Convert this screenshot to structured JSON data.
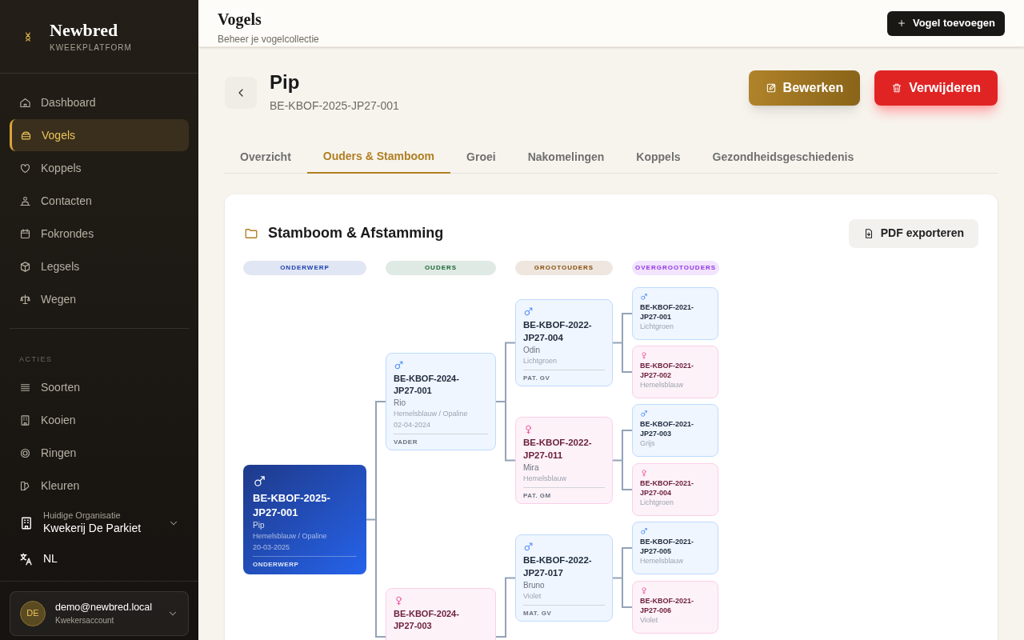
{
  "brand": {
    "name": "Newbred",
    "tagline": "KWEEKPLATFORM"
  },
  "nav": [
    {
      "label": "Dashboard",
      "selected": false
    },
    {
      "label": "Vogels",
      "selected": true
    },
    {
      "label": "Koppels",
      "selected": false
    },
    {
      "label": "Contacten",
      "selected": false
    },
    {
      "label": "Fokrondes",
      "selected": false
    },
    {
      "label": "Legsels",
      "selected": false
    },
    {
      "label": "Wegen",
      "selected": false
    }
  ],
  "section_label": "ACTIES",
  "actions": [
    {
      "label": "Soorten",
      "selected": false
    },
    {
      "label": "Kooien",
      "selected": false
    },
    {
      "label": "Ringen",
      "selected": false
    },
    {
      "label": "Kleuren",
      "selected": false
    }
  ],
  "organization": {
    "label": "Huidige Organisatie",
    "name": "Kwekerij De Parkiet"
  },
  "language": "NL",
  "account": {
    "initials": "DE",
    "email": "demo@newbred.local",
    "role": "Kwekersaccount"
  },
  "header": {
    "title": "Vogels",
    "subtitle": "Beheer je vogelcollectie",
    "add_button": "Vogel toevoegen"
  },
  "bird": {
    "name": "Pip",
    "ring": "BE-KBOF-2025-JP27-001",
    "edit_button": "Bewerken",
    "delete_button": "Verwijderen"
  },
  "tabs": [
    {
      "label": "Overzicht",
      "selected": false
    },
    {
      "label": "Ouders & Stamboom",
      "selected": true
    },
    {
      "label": "Groei",
      "selected": false
    },
    {
      "label": "Nakomelingen",
      "selected": false
    },
    {
      "label": "Koppels",
      "selected": false
    },
    {
      "label": "Gezondheidsgeschiedenis",
      "selected": false
    }
  ],
  "pedigree": {
    "title": "Stamboom & Afstamming",
    "export_button": "PDF exporteren",
    "generations": [
      {
        "label": "ONDERWERP",
        "color": "#1e40af"
      },
      {
        "label": "OUDERS",
        "color": "#166534"
      },
      {
        "label": "GROOTOUDERS",
        "color": "#854d0e"
      },
      {
        "label": "OVERGROOTOUDERS",
        "color": "#9333ea"
      }
    ],
    "subject": {
      "kind": "male",
      "ring": "BE-KBOF-2025-JP27-001",
      "name": "Pip",
      "mutation": "Hemelsblauw / Opaline",
      "date": "20-03-2025",
      "role": "ONDERWERP",
      "parents": [
        {
          "kind": "male",
          "ring": "BE-KBOF-2024-JP27-001",
          "name": "Rio",
          "mutation": "Hemelsblauw / Opaline",
          "date": "02-04-2024",
          "role": "VADER",
          "parents": [
            {
              "kind": "male",
              "ring": "BE-KBOF-2022-JP27-004",
              "name": "Odin",
              "mutation": "Lichtgroen",
              "role": "PAT. GV",
              "parents": [
                {
                  "kind": "male",
                  "ring": "BE-KBOF-2021-JP27-001",
                  "mutation": "Lichtgroen"
                },
                {
                  "kind": "female",
                  "ring": "BE-KBOF-2021-JP27-002",
                  "mutation": "Hemelsblauw"
                }
              ]
            },
            {
              "kind": "female",
              "ring": "BE-KBOF-2022-JP27-011",
              "name": "Mira",
              "mutation": "Hemelsblauw",
              "role": "PAT. GM",
              "parents": [
                {
                  "kind": "male",
                  "ring": "BE-KBOF-2021-JP27-003",
                  "mutation": "Grijs"
                },
                {
                  "kind": "female",
                  "ring": "BE-KBOF-2021-JP27-004",
                  "mutation": "Lichtgroen"
                }
              ]
            }
          ]
        },
        {
          "kind": "female",
          "ring": "BE-KBOF-2024-JP27-003",
          "parents": [
            {
              "kind": "male",
              "ring": "BE-KBOF-2022-JP27-017",
              "name": "Bruno",
              "mutation": "Violet",
              "role": "MAT. GV",
              "parents": [
                {
                  "kind": "male",
                  "ring": "BE-KBOF-2021-JP27-005",
                  "mutation": "Hemelsblauw"
                },
                {
                  "kind": "female",
                  "ring": "BE-KBOF-2021-JP27-006",
                  "mutation": "Violet"
                }
              ]
            }
          ]
        }
      ]
    }
  }
}
